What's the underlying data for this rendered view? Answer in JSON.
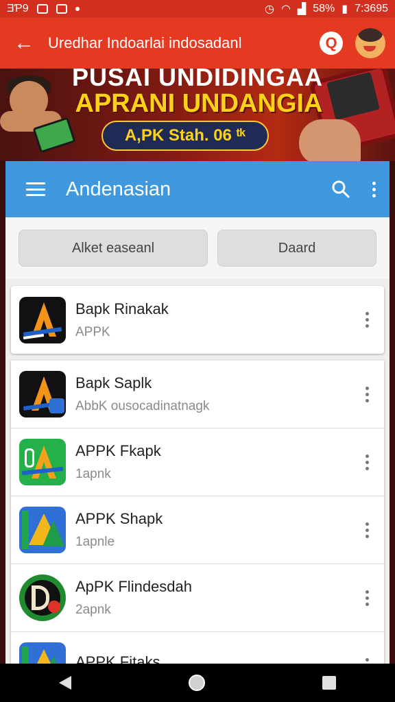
{
  "status_bar": {
    "left_text": "ƎƤ9",
    "battery": "58%",
    "time": "7:3695"
  },
  "app_bar": {
    "title": "Uredhar Indoarlai indosadanl",
    "q_label": "Q"
  },
  "banner": {
    "line1": "PUSAI UNDIDINGAA",
    "line2": "APRANI UNDANGIA",
    "badge": "A,PK Stah. 06 ᵗᵏ"
  },
  "card": {
    "title": "Andenasian",
    "buttons": [
      "Alket easeanl",
      "Daard"
    ]
  },
  "apps": [
    {
      "name": "Bapk Rinakak",
      "sub": "APPK",
      "icon": "app-orange-a-dark-icon"
    },
    {
      "name": "Bapk Saplk",
      "sub": "AbbK ousocadinatnagk",
      "icon": "app-orange-a-badge-icon"
    },
    {
      "name": "APPK Fkapk",
      "sub": "1apnk",
      "icon": "app-green-a-icon"
    },
    {
      "name": "APPK Shapk",
      "sub": "1apnle",
      "icon": "app-drive-blue-icon"
    },
    {
      "name": "ApPK Flindesdah",
      "sub": "2apnk",
      "icon": "app-circle-p-icon"
    },
    {
      "name": "APPK Fitaks",
      "sub": "",
      "icon": "app-drive-green-icon"
    }
  ],
  "colors": {
    "status_bar": "#d32f1f",
    "app_bar": "#e53a22",
    "card_bar": "#3f98de",
    "banner_yellow": "#ffd21a"
  }
}
